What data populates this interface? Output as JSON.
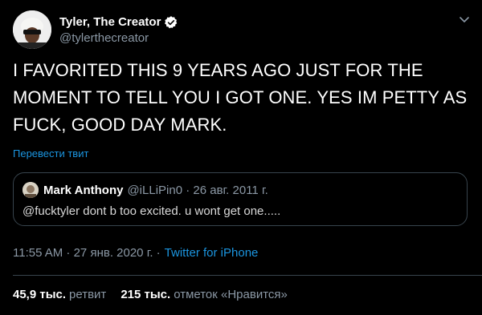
{
  "author": {
    "display_name": "Tyler, The Creator",
    "handle": "@tylerthecreator",
    "verified": true
  },
  "tweet": {
    "text": "I FAVORITED THIS 9 YEARS AGO JUST FOR THE\nMOMENT TO TELL YOU I GOT ONE. YES IM PETTY AS\nFUCK, GOOD DAY MARK.",
    "translate_label": "Перевести твит"
  },
  "quoted_tweet": {
    "display_name": "Mark Anthony",
    "meta": "@iLLiPin0 · 26 авг. 2011 г.",
    "text": "@fucktyler dont b too excited. u wont get one....."
  },
  "timestamp": {
    "time_date": "11:55 AM · 27 янв. 2020 г. ·",
    "source": "Twitter for iPhone"
  },
  "stats": {
    "retweets_value": "45,9 тыс.",
    "retweets_label": "ретвит",
    "likes_value": "215 тыс.",
    "likes_label": "отметок «Нравится»"
  },
  "icons": {
    "verified": "verified-badge-icon",
    "more": "chevron-down-icon"
  },
  "colors": {
    "background": "#000000",
    "link": "#1b95e0",
    "secondary_text": "#8b98a5",
    "border": "#38444d"
  }
}
